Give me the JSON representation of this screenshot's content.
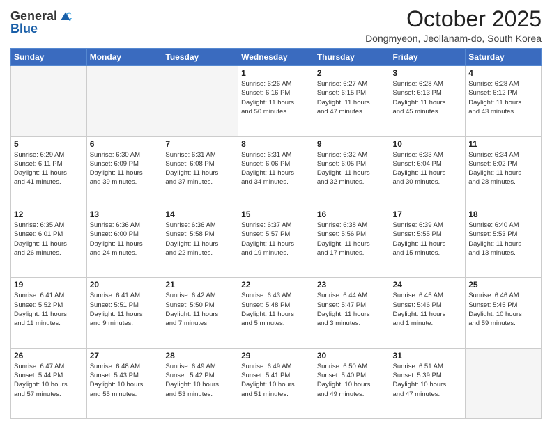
{
  "logo": {
    "line1": "General",
    "line2": "Blue"
  },
  "title": "October 2025",
  "location": "Dongmyeon, Jeollanam-do, South Korea",
  "weekdays": [
    "Sunday",
    "Monday",
    "Tuesday",
    "Wednesday",
    "Thursday",
    "Friday",
    "Saturday"
  ],
  "weeks": [
    [
      {
        "day": "",
        "text": ""
      },
      {
        "day": "",
        "text": ""
      },
      {
        "day": "",
        "text": ""
      },
      {
        "day": "1",
        "text": "Sunrise: 6:26 AM\nSunset: 6:16 PM\nDaylight: 11 hours\nand 50 minutes."
      },
      {
        "day": "2",
        "text": "Sunrise: 6:27 AM\nSunset: 6:15 PM\nDaylight: 11 hours\nand 47 minutes."
      },
      {
        "day": "3",
        "text": "Sunrise: 6:28 AM\nSunset: 6:13 PM\nDaylight: 11 hours\nand 45 minutes."
      },
      {
        "day": "4",
        "text": "Sunrise: 6:28 AM\nSunset: 6:12 PM\nDaylight: 11 hours\nand 43 minutes."
      }
    ],
    [
      {
        "day": "5",
        "text": "Sunrise: 6:29 AM\nSunset: 6:11 PM\nDaylight: 11 hours\nand 41 minutes."
      },
      {
        "day": "6",
        "text": "Sunrise: 6:30 AM\nSunset: 6:09 PM\nDaylight: 11 hours\nand 39 minutes."
      },
      {
        "day": "7",
        "text": "Sunrise: 6:31 AM\nSunset: 6:08 PM\nDaylight: 11 hours\nand 37 minutes."
      },
      {
        "day": "8",
        "text": "Sunrise: 6:31 AM\nSunset: 6:06 PM\nDaylight: 11 hours\nand 34 minutes."
      },
      {
        "day": "9",
        "text": "Sunrise: 6:32 AM\nSunset: 6:05 PM\nDaylight: 11 hours\nand 32 minutes."
      },
      {
        "day": "10",
        "text": "Sunrise: 6:33 AM\nSunset: 6:04 PM\nDaylight: 11 hours\nand 30 minutes."
      },
      {
        "day": "11",
        "text": "Sunrise: 6:34 AM\nSunset: 6:02 PM\nDaylight: 11 hours\nand 28 minutes."
      }
    ],
    [
      {
        "day": "12",
        "text": "Sunrise: 6:35 AM\nSunset: 6:01 PM\nDaylight: 11 hours\nand 26 minutes."
      },
      {
        "day": "13",
        "text": "Sunrise: 6:36 AM\nSunset: 6:00 PM\nDaylight: 11 hours\nand 24 minutes."
      },
      {
        "day": "14",
        "text": "Sunrise: 6:36 AM\nSunset: 5:58 PM\nDaylight: 11 hours\nand 22 minutes."
      },
      {
        "day": "15",
        "text": "Sunrise: 6:37 AM\nSunset: 5:57 PM\nDaylight: 11 hours\nand 19 minutes."
      },
      {
        "day": "16",
        "text": "Sunrise: 6:38 AM\nSunset: 5:56 PM\nDaylight: 11 hours\nand 17 minutes."
      },
      {
        "day": "17",
        "text": "Sunrise: 6:39 AM\nSunset: 5:55 PM\nDaylight: 11 hours\nand 15 minutes."
      },
      {
        "day": "18",
        "text": "Sunrise: 6:40 AM\nSunset: 5:53 PM\nDaylight: 11 hours\nand 13 minutes."
      }
    ],
    [
      {
        "day": "19",
        "text": "Sunrise: 6:41 AM\nSunset: 5:52 PM\nDaylight: 11 hours\nand 11 minutes."
      },
      {
        "day": "20",
        "text": "Sunrise: 6:41 AM\nSunset: 5:51 PM\nDaylight: 11 hours\nand 9 minutes."
      },
      {
        "day": "21",
        "text": "Sunrise: 6:42 AM\nSunset: 5:50 PM\nDaylight: 11 hours\nand 7 minutes."
      },
      {
        "day": "22",
        "text": "Sunrise: 6:43 AM\nSunset: 5:48 PM\nDaylight: 11 hours\nand 5 minutes."
      },
      {
        "day": "23",
        "text": "Sunrise: 6:44 AM\nSunset: 5:47 PM\nDaylight: 11 hours\nand 3 minutes."
      },
      {
        "day": "24",
        "text": "Sunrise: 6:45 AM\nSunset: 5:46 PM\nDaylight: 11 hours\nand 1 minute."
      },
      {
        "day": "25",
        "text": "Sunrise: 6:46 AM\nSunset: 5:45 PM\nDaylight: 10 hours\nand 59 minutes."
      }
    ],
    [
      {
        "day": "26",
        "text": "Sunrise: 6:47 AM\nSunset: 5:44 PM\nDaylight: 10 hours\nand 57 minutes."
      },
      {
        "day": "27",
        "text": "Sunrise: 6:48 AM\nSunset: 5:43 PM\nDaylight: 10 hours\nand 55 minutes."
      },
      {
        "day": "28",
        "text": "Sunrise: 6:49 AM\nSunset: 5:42 PM\nDaylight: 10 hours\nand 53 minutes."
      },
      {
        "day": "29",
        "text": "Sunrise: 6:49 AM\nSunset: 5:41 PM\nDaylight: 10 hours\nand 51 minutes."
      },
      {
        "day": "30",
        "text": "Sunrise: 6:50 AM\nSunset: 5:40 PM\nDaylight: 10 hours\nand 49 minutes."
      },
      {
        "day": "31",
        "text": "Sunrise: 6:51 AM\nSunset: 5:39 PM\nDaylight: 10 hours\nand 47 minutes."
      },
      {
        "day": "",
        "text": ""
      }
    ]
  ]
}
